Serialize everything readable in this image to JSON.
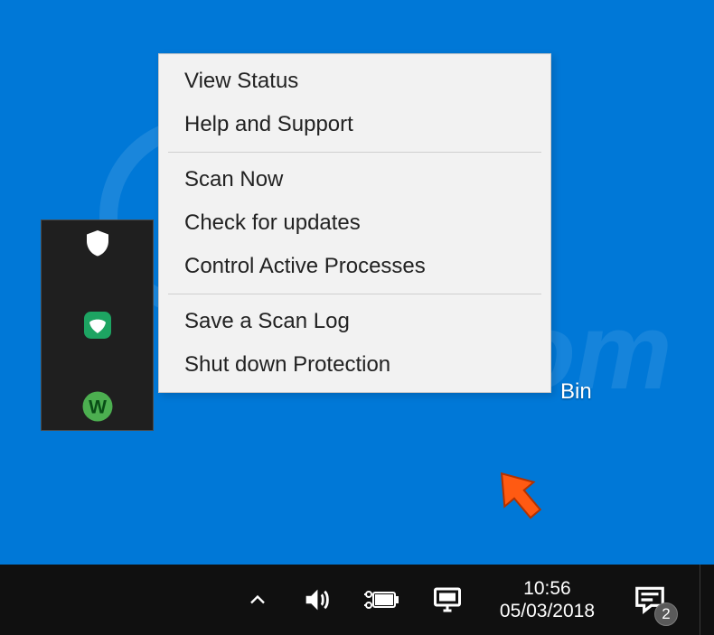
{
  "context_menu": {
    "group1": [
      {
        "label": "View Status"
      },
      {
        "label": "Help and Support"
      }
    ],
    "group2": [
      {
        "label": "Scan Now"
      },
      {
        "label": "Check for updates"
      },
      {
        "label": "Control Active Processes"
      }
    ],
    "group3": [
      {
        "label": "Save a Scan Log"
      },
      {
        "label": "Shut down Protection"
      }
    ]
  },
  "desktop": {
    "bin_label": "Bin"
  },
  "taskbar": {
    "time": "10:56",
    "date": "05/03/2018",
    "notification_count": "2"
  }
}
